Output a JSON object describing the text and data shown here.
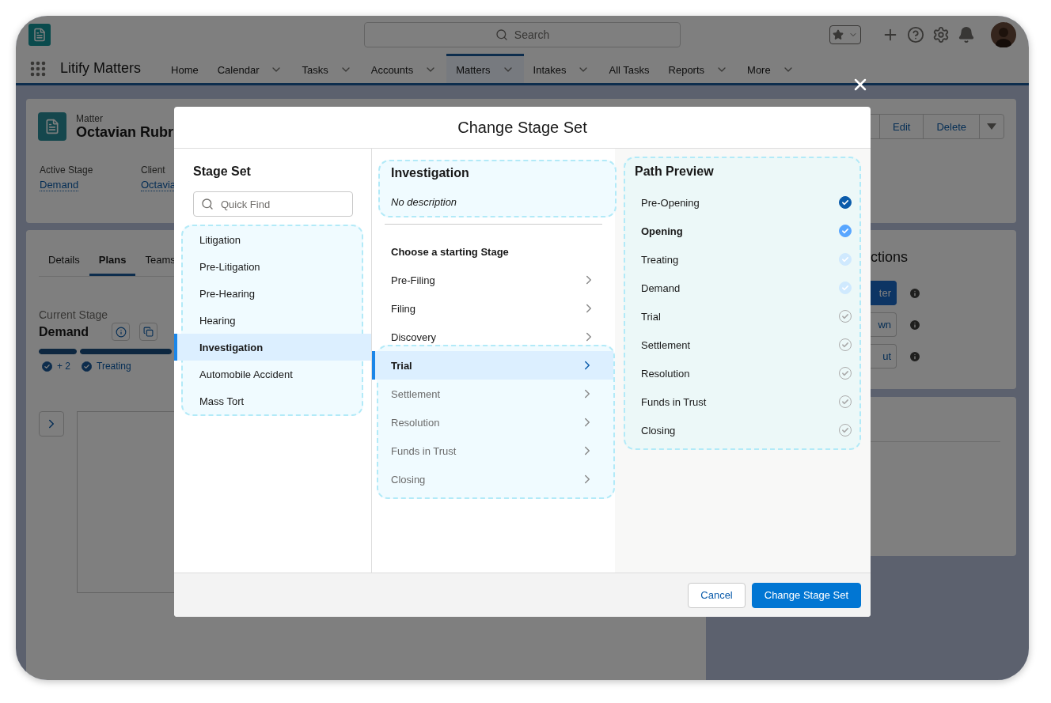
{
  "header": {
    "search": {
      "placeholder": "Search"
    }
  },
  "nav": {
    "app_name": "Litify Matters",
    "items": [
      {
        "label": "Home",
        "dropdown": false,
        "selected": false
      },
      {
        "label": "Calendar",
        "dropdown": true,
        "selected": false
      },
      {
        "label": "Tasks",
        "dropdown": true,
        "selected": false
      },
      {
        "label": "Accounts",
        "dropdown": true,
        "selected": false
      },
      {
        "label": "Matters",
        "dropdown": true,
        "selected": true
      },
      {
        "label": "Intakes",
        "dropdown": true,
        "selected": false
      },
      {
        "label": "All Tasks",
        "dropdown": false,
        "selected": false
      },
      {
        "label": "Reports",
        "dropdown": true,
        "selected": false
      },
      {
        "label": "More",
        "dropdown": true,
        "selected": false
      }
    ]
  },
  "record": {
    "object_label": "Matter",
    "name": "Octavian Rubr",
    "actions": [
      "Edit",
      "Delete"
    ],
    "fields": [
      {
        "label": "Active Stage",
        "value": "Demand"
      },
      {
        "label": "Client",
        "value": "Octavia"
      }
    ]
  },
  "plans_card": {
    "tabs": [
      {
        "label": "Details",
        "selected": false
      },
      {
        "label": "Plans",
        "selected": true
      },
      {
        "label": "Teams",
        "selected": false
      }
    ],
    "current_stage_label": "Current Stage",
    "current_stage": "Demand",
    "progress_bars": [
      {
        "level": 1
      },
      {
        "level": 1
      }
    ],
    "progress": [
      {
        "label": "+ 2"
      },
      {
        "label": "Treating"
      }
    ]
  },
  "actions_card": {
    "title": "ctions",
    "buttons": [
      {
        "label": "ter",
        "primary": true
      },
      {
        "label": "wn",
        "primary": false
      },
      {
        "label": "ut",
        "primary": false
      }
    ]
  },
  "modal": {
    "title": "Change Stage Set",
    "stage_set": {
      "heading": "Stage Set",
      "search": {
        "placeholder": "Quick Find"
      },
      "items": [
        {
          "label": "Litigation",
          "selected": false
        },
        {
          "label": "Pre-Litigation",
          "selected": false
        },
        {
          "label": "Pre-Hearing",
          "selected": false
        },
        {
          "label": "Hearing",
          "selected": false
        },
        {
          "label": "Investigation",
          "selected": true
        },
        {
          "label": "Automobile Accident",
          "selected": false
        },
        {
          "label": "Mass Tort",
          "selected": false
        }
      ]
    },
    "details": {
      "title": "Investigation",
      "description": "No description",
      "prompt": "Choose a starting Stage",
      "stage_groups": [
        {
          "highlighted": false,
          "stages": [
            {
              "label": "Pre-Filing",
              "selected": false,
              "muted": false
            },
            {
              "label": "Filing",
              "selected": false,
              "muted": false
            },
            {
              "label": "Discovery",
              "selected": false,
              "muted": false
            }
          ]
        },
        {
          "highlighted": true,
          "stages": [
            {
              "label": "Trial",
              "selected": true,
              "muted": false
            },
            {
              "label": "Settlement",
              "selected": false,
              "muted": true
            },
            {
              "label": "Resolution",
              "selected": false,
              "muted": true
            },
            {
              "label": "Funds in Trust",
              "selected": false,
              "muted": true
            },
            {
              "label": "Closing",
              "selected": false,
              "muted": true
            }
          ]
        }
      ]
    },
    "path_preview": {
      "heading": "Path Preview",
      "stages": [
        {
          "label": "Pre-Opening",
          "kind": "completed"
        },
        {
          "label": "Opening",
          "kind": "current"
        },
        {
          "label": "Treating",
          "kind": "passed"
        },
        {
          "label": "Demand",
          "kind": "passed"
        },
        {
          "label": "Trial",
          "kind": "pending"
        },
        {
          "label": "Settlement",
          "kind": "pending"
        },
        {
          "label": "Resolution",
          "kind": "pending"
        },
        {
          "label": "Funds in Trust",
          "kind": "pending"
        },
        {
          "label": "Closing",
          "kind": "pending"
        }
      ]
    },
    "buttons": [
      {
        "label": "Cancel",
        "primary": false
      },
      {
        "label": "Change Stage Set",
        "primary": true
      }
    ]
  }
}
